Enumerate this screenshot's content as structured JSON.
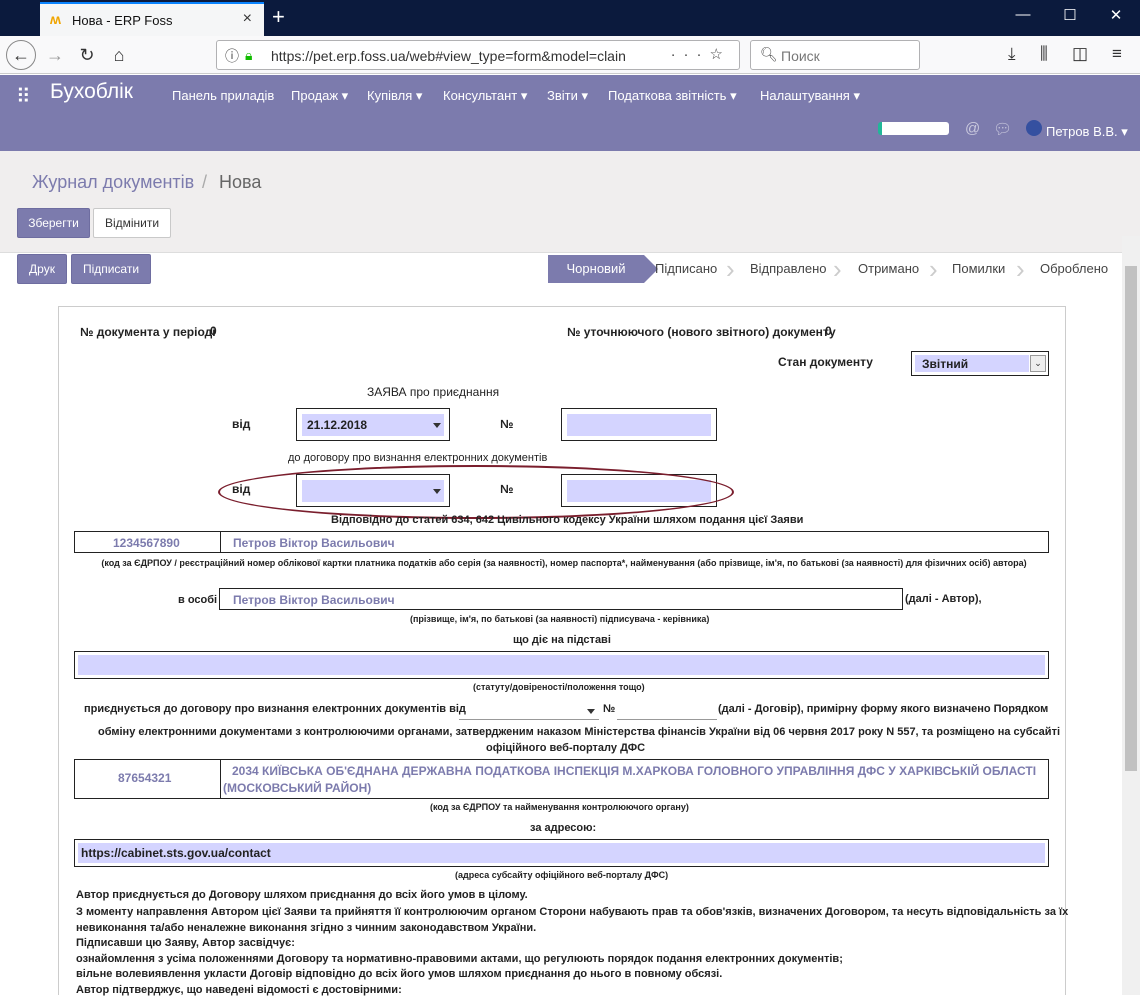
{
  "browser": {
    "tab_title": "Нова - ERP Foss",
    "url": "https://pet.erp.foss.ua/web#view_type=form&model=clain",
    "search_placeholder": "Поиск",
    "new_tab": "+",
    "minimize": "—",
    "maximize": "☐",
    "close": "✕"
  },
  "app": {
    "brand": "Бухоблік",
    "menu": [
      "Панель приладів",
      "Продаж",
      "Купівля",
      "Консультант",
      "Звіти",
      "Податкова звітність",
      "Налаштування"
    ],
    "user": "Петров В.В."
  },
  "breadcrumb": {
    "parent": "Журнал документів",
    "sep": "/",
    "current": "Нова"
  },
  "buttons": {
    "save": "Зберегти",
    "discard": "Відмінити",
    "print": "Друк",
    "sign": "Підписати"
  },
  "stages": [
    "Чорновий",
    "Підписано",
    "Відправлено",
    "Отримано",
    "Помилки",
    "Оброблено"
  ],
  "form": {
    "doc_num_label": "№ документа у періоді",
    "doc_num_value": "0",
    "refine_label": "№ уточнюючого (нового звітного) документу",
    "refine_value": "0",
    "state_label": "Стан документу",
    "state_value": "Звітний",
    "title": "ЗАЯВА про приєднання",
    "from_label": "від",
    "date_value": "21.12.2018",
    "num_label": "№",
    "contract_title": "до договору про визнання електронних документів",
    "from_label2": "від",
    "num_label2": "№",
    "basis_text": "Відповідно до статей 634, 642 Цивільного кодексу України шляхом подання цієї Заяви",
    "code_value": "1234567890",
    "name_value": "Петров Віктор Васильович",
    "code_caption": "(код за ЄДРПОУ / реєстраційний номер облікової картки платника податків або серія (за наявності), номер паспорта*, найменування (або прізвище, ім'я, по батькові (за наявності) для фізичних осіб) автора)",
    "person_label": "в особі",
    "person_value": "Петров Віктор Васильович",
    "author_suffix": "(далі - Автор),",
    "person_caption": "(прізвище, ім'я, по батькові (за наявності) підписувача - керівника)",
    "acting_label": "що діє на підставі",
    "acting_caption": "(статуту/довіреності/положення тощо)",
    "join_text_a": "приєднується до договору про визнання електронних документів від",
    "join_num": "№",
    "join_text_b": "(далі - Договір), примірну форму якого визначено Порядком",
    "join_text_c": "обміну електронними документами з контролюючими органами, затвердженим наказом Міністерства фінансів України від 06 червня 2017 року N 557, та розміщено на субсайті",
    "join_text_d": "офіційного веб-порталу ДФС",
    "org_code": "87654321",
    "org_name_1": "2034  КИЇВСЬКА ОБ'ЄДНАНА ДЕРЖАВНА ПОДАТКОВА ІНСПЕКЦІЯ М.ХАРКОВА ГОЛОВНОГО УПРАВЛІННЯ ДФС У ХАРКІВСЬКІЙ ОБЛАСТІ",
    "org_name_2": "(МОСКОВСЬКИЙ РАЙОН)",
    "org_caption": "(код за ЄДРПОУ та найменування контролюючого органу)",
    "address_label": "за адресою:",
    "address_value": "https://cabinet.sts.gov.ua/contact",
    "address_caption": "(адреса субсайту офіційного веб-порталу ДФС)",
    "para": [
      "Автор приєднується до Договору шляхом приєднання до всіх його умов в цілому.",
      "З моменту направлення Автором цієї Заяви та прийняття її контролюючим органом Сторони набувають прав та обов'язків, визначених Договором, та несуть відповідальність за їх",
      "невиконання та/або неналежне виконання згідно з чинним законодавством України.",
      "Підписавши цю Заяву, Автор засвідчує:",
      "ознайомлення з усіма положеннями Договору та нормативно-правовими актами, що регулюють порядок подання електронних документів;",
      "вільне волевиявлення укласти Договір відповідно до всіх його умов шляхом приєднання до нього в повному обсязі.",
      "Автор підтверджує, що наведені відомості є достовірними:"
    ]
  }
}
